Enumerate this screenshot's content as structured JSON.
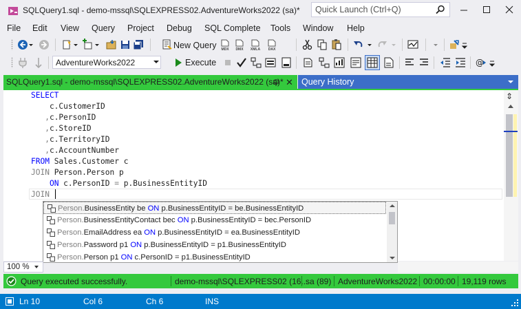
{
  "window": {
    "title": "SQLQuery1.sql - demo-mssql\\SQLEXPRESS02.AdventureWorks2022 (sa)*",
    "quick_launch_placeholder": "Quick Launch (Ctrl+Q)"
  },
  "menu": [
    "File",
    "Edit",
    "View",
    "Query",
    "Project",
    "Debug",
    "SQL Complete",
    "Tools",
    "Window",
    "Help"
  ],
  "toolbar1": {
    "new_query_label": "New Query",
    "small_labels": [
      "MDX",
      "DMX",
      "XMLA",
      "DAX"
    ]
  },
  "toolbar2": {
    "database": "AdventureWorks2022",
    "execute_label": "Execute"
  },
  "tabs": {
    "active": "SQLQuery1.sql - demo-mssql\\SQLEXPRESS02.AdventureWorks2022 (sa)*",
    "inactive": "Query History"
  },
  "editor": {
    "lines": [
      {
        "parts": [
          {
            "t": "SELECT",
            "c": "kw"
          }
        ]
      },
      {
        "parts": [
          {
            "t": "    c.CustomerID",
            "c": ""
          }
        ]
      },
      {
        "parts": [
          {
            "t": "   ,",
            "c": "gray"
          },
          {
            "t": "c.PersonID",
            "c": ""
          }
        ]
      },
      {
        "parts": [
          {
            "t": "   ,",
            "c": "gray"
          },
          {
            "t": "c.StoreID",
            "c": ""
          }
        ]
      },
      {
        "parts": [
          {
            "t": "   ,",
            "c": "gray"
          },
          {
            "t": "c.TerritoryID",
            "c": ""
          }
        ]
      },
      {
        "parts": [
          {
            "t": "   ,",
            "c": "gray"
          },
          {
            "t": "c.AccountNumber",
            "c": ""
          }
        ]
      },
      {
        "parts": [
          {
            "t": "FROM",
            "c": "kw"
          },
          {
            "t": " Sales.Customer c",
            "c": ""
          }
        ]
      },
      {
        "parts": [
          {
            "t": "JOIN",
            "c": "gray"
          },
          {
            "t": " Person.Person p",
            "c": ""
          }
        ]
      },
      {
        "parts": [
          {
            "t": "    ",
            "c": ""
          },
          {
            "t": "ON",
            "c": "kw"
          },
          {
            "t": " c.PersonID ",
            "c": ""
          },
          {
            "t": "=",
            "c": "gray"
          },
          {
            "t": " p.BusinessEntityID",
            "c": ""
          }
        ]
      },
      {
        "parts": [
          {
            "t": "JOIN",
            "c": "gray"
          }
        ]
      }
    ]
  },
  "suggestions": [
    {
      "schema": "Person.",
      "table": "BusinessEntity be ",
      "on": "ON",
      "cond": " p.BusinessEntityID = be.BusinessEntityID"
    },
    {
      "schema": "Person.",
      "table": "BusinessEntityContact bec ",
      "on": "ON",
      "cond": " p.BusinessEntityID = bec.PersonID"
    },
    {
      "schema": "Person.",
      "table": "EmailAddress ea ",
      "on": "ON",
      "cond": " p.BusinessEntityID = ea.BusinessEntityID"
    },
    {
      "schema": "Person.",
      "table": "Password p1 ",
      "on": "ON",
      "cond": " p.BusinessEntityID = p1.BusinessEntityID"
    },
    {
      "schema": "Person.",
      "table": "Person p1 ",
      "on": "ON",
      "cond": " c.PersonID = p1.BusinessEntityID"
    }
  ],
  "zoom": "100 %",
  "query_status": {
    "message": "Query executed successfully.",
    "server": "demo-mssql\\SQLEXPRESS02 (16...",
    "user": "sa (89)",
    "database": "AdventureWorks2022",
    "elapsed": "00:00:00",
    "rows": "19,119 rows"
  },
  "app_status": {
    "line": "Ln 10",
    "col": "Col 6",
    "ch": "Ch 6",
    "mode": "INS"
  },
  "colors": {
    "accent_green": "#34c93d",
    "accent_blue": "#007acc",
    "keyword_blue": "#0000ff"
  }
}
